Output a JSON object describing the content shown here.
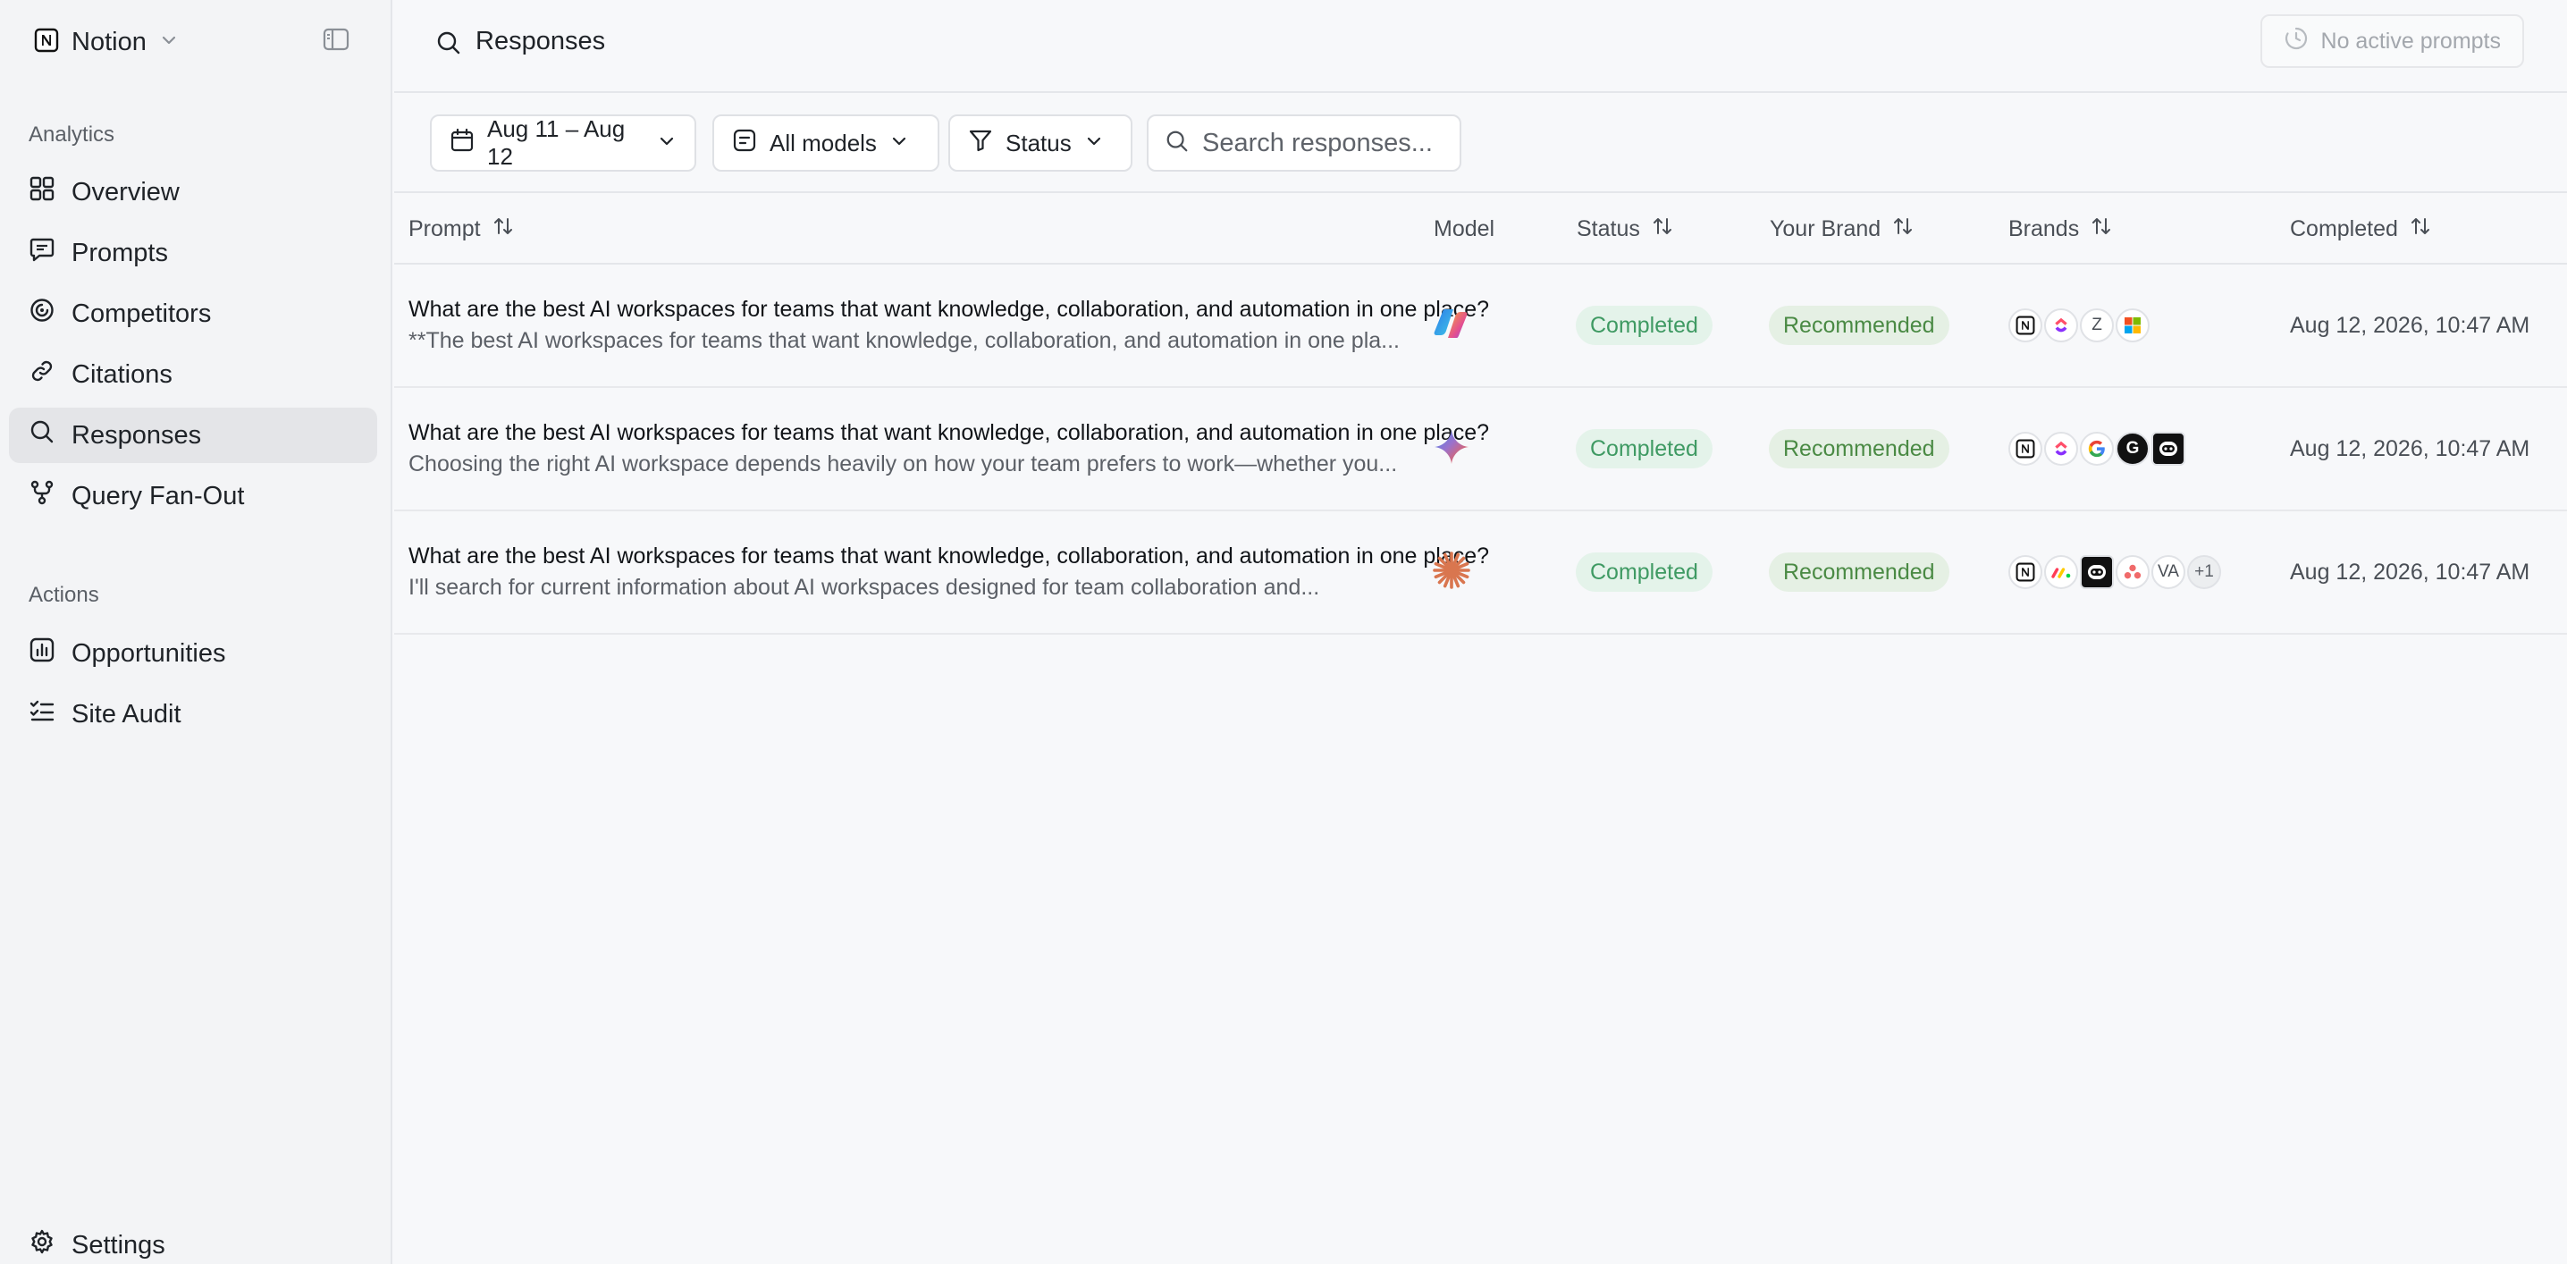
{
  "workspace": {
    "name": "Notion"
  },
  "sidebar": {
    "analytics_label": "Analytics",
    "items": [
      {
        "label": "Overview",
        "icon": "grid-icon"
      },
      {
        "label": "Prompts",
        "icon": "chat-icon"
      },
      {
        "label": "Competitors",
        "icon": "target-icon"
      },
      {
        "label": "Citations",
        "icon": "link-icon"
      },
      {
        "label": "Responses",
        "icon": "search-icon",
        "active": true
      },
      {
        "label": "Query Fan-Out",
        "icon": "branch-icon"
      }
    ],
    "actions_label": "Actions",
    "actions": [
      {
        "label": "Opportunities",
        "icon": "chart-icon"
      },
      {
        "label": "Site Audit",
        "icon": "checklist-icon"
      }
    ],
    "settings_label": "Settings"
  },
  "header": {
    "title": "Responses",
    "status_button": "No active prompts"
  },
  "filters": {
    "date_range": "Aug 11 – Aug 12",
    "model": "All models",
    "status": "Status",
    "search_placeholder": "Search responses..."
  },
  "table": {
    "columns": {
      "prompt": "Prompt",
      "model": "Model",
      "status": "Status",
      "your_brand": "Your Brand",
      "brands": "Brands",
      "completed": "Completed"
    },
    "rows": [
      {
        "prompt": "What are the best AI workspaces for teams that want knowledge, collaboration, and automation in one place?",
        "excerpt": "**The best AI workspaces for teams that want knowledge, collaboration, and automation in one pla...",
        "model_icon": "copilot-icon",
        "status": "Completed",
        "your_brand": "Recommended",
        "brands": [
          "notion",
          "clickup",
          "Z",
          "microsoft"
        ],
        "completed": "Aug 12, 2026, 10:47 AM"
      },
      {
        "prompt": "What are the best AI workspaces for teams that want knowledge, collaboration, and automation in one place?",
        "excerpt": "Choosing the right AI workspace depends heavily on how your team prefers to work—whether you...",
        "model_icon": "gemini-icon",
        "status": "Completed",
        "your_brand": "Recommended",
        "brands": [
          "notion",
          "clickup",
          "google",
          "G",
          "robot"
        ],
        "completed": "Aug 12, 2026, 10:47 AM"
      },
      {
        "prompt": "What are the best AI workspaces for teams that want knowledge, collaboration, and automation in one place?",
        "excerpt": "I'll search for current information about AI workspaces designed for team collaboration and...",
        "model_icon": "claude-icon",
        "status": "Completed",
        "your_brand": "Recommended",
        "brands": [
          "notion",
          "monday",
          "robot",
          "asana",
          "VA"
        ],
        "extra_brands": "+1",
        "completed": "Aug 12, 2026, 10:47 AM"
      }
    ]
  }
}
